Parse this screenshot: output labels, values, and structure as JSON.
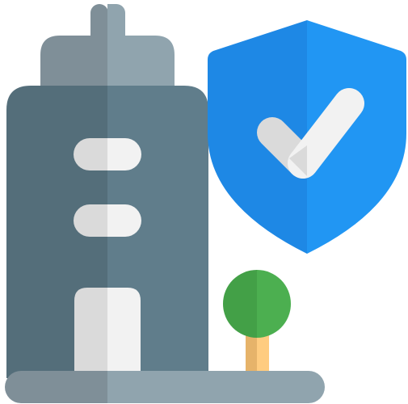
{
  "icon": {
    "name": "secure-building-icon",
    "parts": [
      "building-icon",
      "shield-icon",
      "check-icon",
      "tree-icon"
    ]
  },
  "colors": {
    "building_dark": "#546e7a",
    "building_light": "#607d8b",
    "building_top_dark": "#7f8f98",
    "building_top_light": "#90a4ae",
    "window_dark": "#dadada",
    "window_light": "#f2f2f2",
    "shield_dark": "#1e88e5",
    "shield_light": "#2196f3",
    "check_dark": "#dadada",
    "check_light": "#f2f2f2",
    "tree_dark": "#43a047",
    "tree_light": "#4caf50",
    "trunk_dark": "#e6b36a",
    "trunk_light": "#ffcc80",
    "ground_dark": "#7f8f98",
    "ground_light": "#90a4ae"
  }
}
